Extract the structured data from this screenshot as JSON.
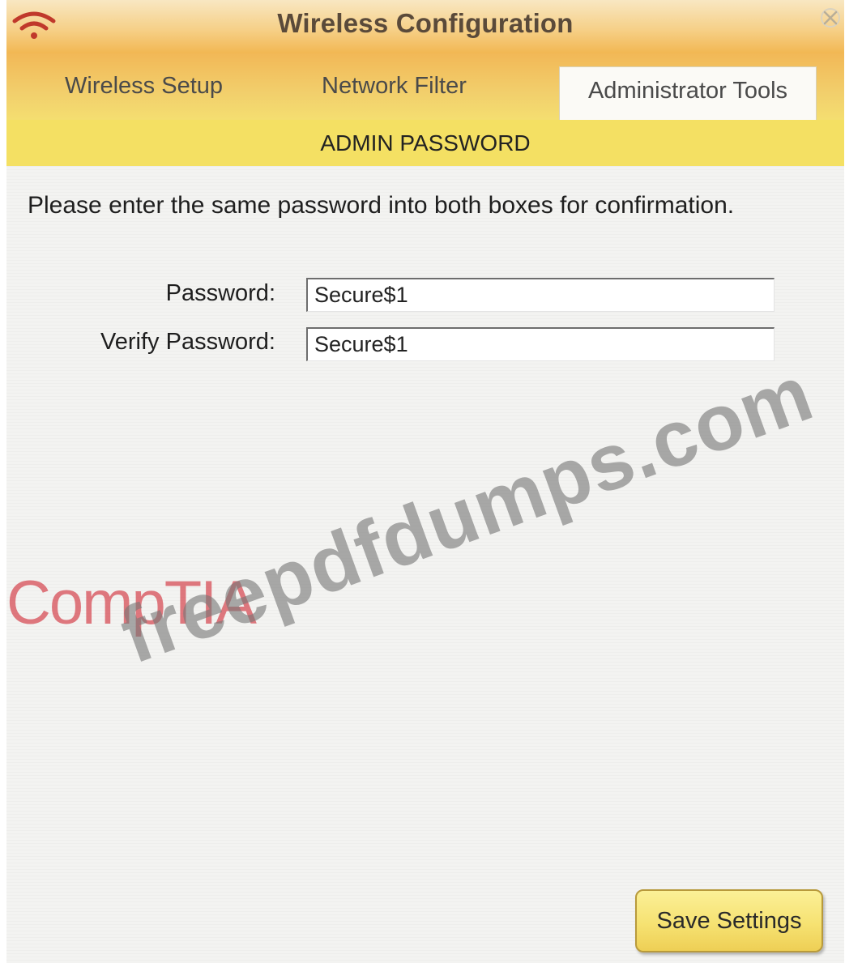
{
  "window": {
    "title": "Wireless Configuration"
  },
  "tabs": [
    {
      "label": "Wireless Setup",
      "active": false
    },
    {
      "label": "Network Filter",
      "active": false
    },
    {
      "label": "Administrator Tools",
      "active": true
    }
  ],
  "section": {
    "title": "ADMIN PASSWORD",
    "instructions": "Please enter the same password into both boxes for confirmation."
  },
  "form": {
    "password_label": "Password:",
    "password_value": "Secure$1",
    "verify_label": "Verify Password:",
    "verify_value": "Secure$1"
  },
  "actions": {
    "save_label": "Save Settings"
  },
  "watermarks": {
    "site": "freepdfdumps.com",
    "logo": "CompTIA"
  },
  "colors": {
    "title_bar_gradient_top": "#f8e7c2",
    "title_bar_gradient_bottom": "#f2b752",
    "section_bar": "#f4e063",
    "button_fill": "#f6e272",
    "logo_watermark": "#d64650"
  },
  "icons": {
    "app": "wifi-icon",
    "close": "close-icon"
  }
}
